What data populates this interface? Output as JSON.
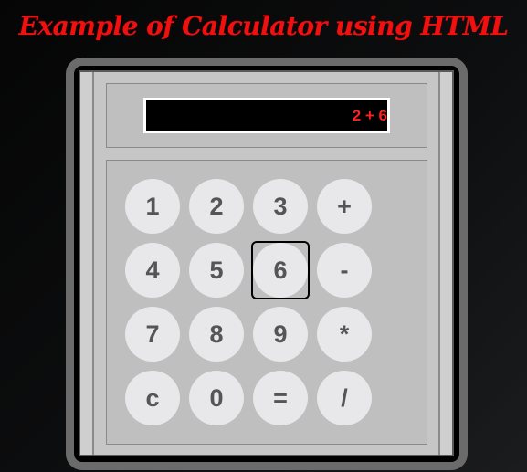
{
  "title": "Example of Calculator using HTML",
  "display": {
    "value": "2 + 6"
  },
  "keys": [
    [
      "1",
      "2",
      "3",
      "+"
    ],
    [
      "4",
      "5",
      "6",
      "-"
    ],
    [
      "7",
      "8",
      "9",
      "*"
    ],
    [
      "c",
      "0",
      "=",
      "/"
    ]
  ],
  "focused_key": "6",
  "colors": {
    "title": "#f01010",
    "display_text": "#ff2020",
    "display_bg": "#000000",
    "key_bg": "#e8e8ea",
    "key_text": "#555555",
    "body": "#c6c6c6",
    "frame": "#6b6b6b"
  }
}
